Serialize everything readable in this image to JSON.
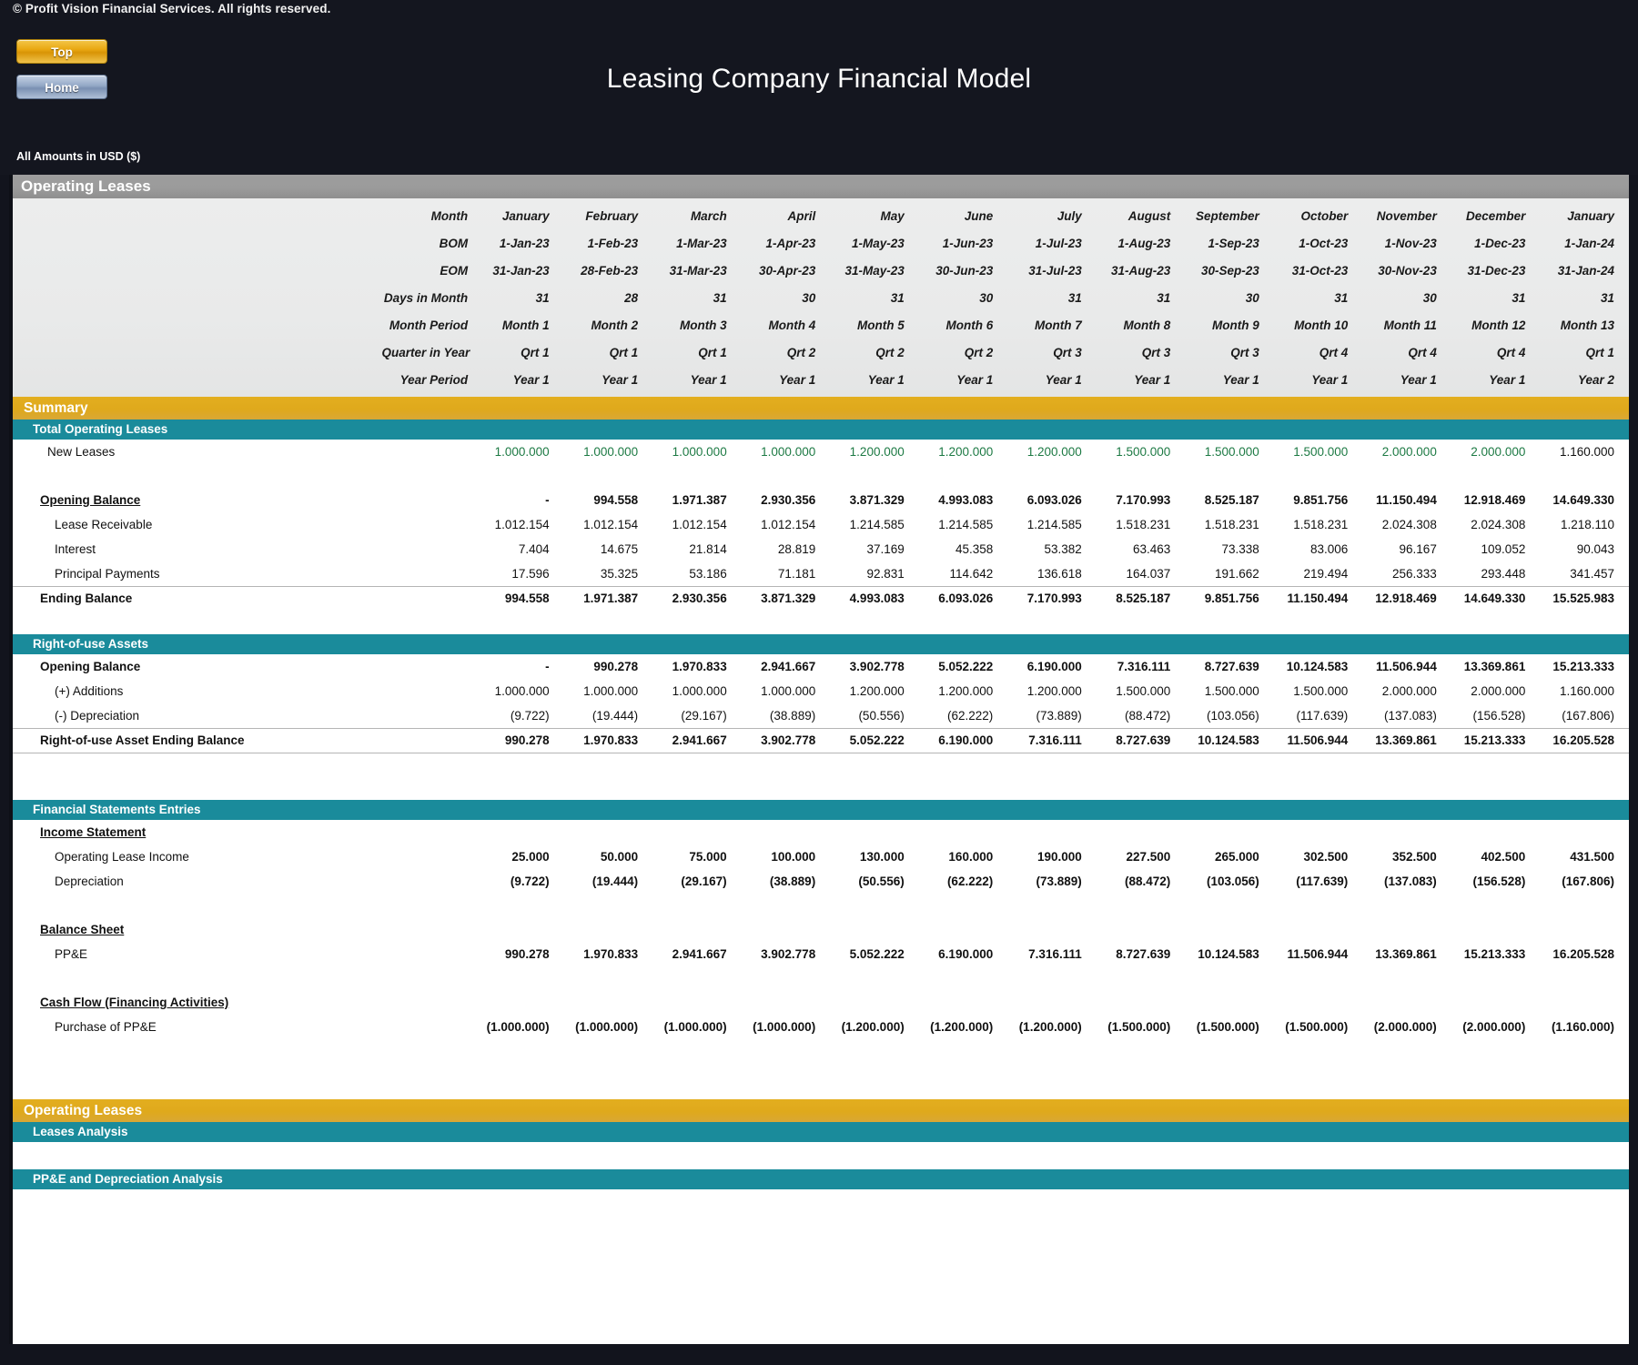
{
  "header": {
    "copyright": "© Profit Vision Financial Services. All rights reserved.",
    "nav_top": "Top",
    "nav_home": "Home",
    "title": "Leasing Company Financial Model",
    "amounts_note": "All Amounts in  USD ($)"
  },
  "sheet": {
    "page_banner": "Operating Leases",
    "summary_banner": "Summary",
    "total_operating_leases_banner": "Total Operating Leases",
    "rou_banner": "Right-of-use Assets",
    "fse_banner": "Financial Statements Entries",
    "bottom_gold_banner": "Operating Leases",
    "leases_analysis_banner": "Leases Analysis",
    "ppe_depreciation_banner": "PP&E and Depreciation Analysis"
  },
  "date_header": {
    "row_labels": [
      "Month",
      "BOM",
      "EOM",
      "Days in Month",
      "Month Period",
      "Quarter in Year",
      "Year Period"
    ],
    "month": [
      "January",
      "February",
      "March",
      "April",
      "May",
      "June",
      "July",
      "August",
      "September",
      "October",
      "November",
      "December",
      "January"
    ],
    "bom": [
      "1-Jan-23",
      "1-Feb-23",
      "1-Mar-23",
      "1-Apr-23",
      "1-May-23",
      "1-Jun-23",
      "1-Jul-23",
      "1-Aug-23",
      "1-Sep-23",
      "1-Oct-23",
      "1-Nov-23",
      "1-Dec-23",
      "1-Jan-24"
    ],
    "eom": [
      "31-Jan-23",
      "28-Feb-23",
      "31-Mar-23",
      "30-Apr-23",
      "31-May-23",
      "30-Jun-23",
      "31-Jul-23",
      "31-Aug-23",
      "30-Sep-23",
      "31-Oct-23",
      "30-Nov-23",
      "31-Dec-23",
      "31-Jan-24"
    ],
    "days_in_month": [
      "31",
      "28",
      "31",
      "30",
      "31",
      "30",
      "31",
      "31",
      "30",
      "31",
      "30",
      "31",
      "31"
    ],
    "month_period": [
      "Month 1",
      "Month 2",
      "Month 3",
      "Month 4",
      "Month 5",
      "Month 6",
      "Month 7",
      "Month 8",
      "Month 9",
      "Month 10",
      "Month 11",
      "Month 12",
      "Month 13"
    ],
    "quarter": [
      "Qrt 1",
      "Qrt 1",
      "Qrt 1",
      "Qrt 2",
      "Qrt 2",
      "Qrt 2",
      "Qrt 3",
      "Qrt 3",
      "Qrt 3",
      "Qrt 4",
      "Qrt 4",
      "Qrt 4",
      "Qrt 1"
    ],
    "year_period": [
      "Year 1",
      "Year 1",
      "Year 1",
      "Year 1",
      "Year 1",
      "Year 1",
      "Year 1",
      "Year 1",
      "Year 1",
      "Year 1",
      "Year 1",
      "Year 1",
      "Year 2"
    ]
  },
  "total_operating_leases": {
    "new_leases": {
      "label": "New Leases",
      "values": [
        "1.000.000",
        "1.000.000",
        "1.000.000",
        "1.000.000",
        "1.200.000",
        "1.200.000",
        "1.200.000",
        "1.500.000",
        "1.500.000",
        "1.500.000",
        "2.000.000",
        "2.000.000",
        "1.160.000"
      ]
    },
    "opening_balance": {
      "label": "Opening Balance",
      "values": [
        "-",
        "994.558",
        "1.971.387",
        "2.930.356",
        "3.871.329",
        "4.993.083",
        "6.093.026",
        "7.170.993",
        "8.525.187",
        "9.851.756",
        "11.150.494",
        "12.918.469",
        "14.649.330"
      ]
    },
    "lease_receivable": {
      "label": "Lease Receivable",
      "values": [
        "1.012.154",
        "1.012.154",
        "1.012.154",
        "1.012.154",
        "1.214.585",
        "1.214.585",
        "1.214.585",
        "1.518.231",
        "1.518.231",
        "1.518.231",
        "2.024.308",
        "2.024.308",
        "1.218.110"
      ]
    },
    "interest": {
      "label": "Interest",
      "values": [
        "7.404",
        "14.675",
        "21.814",
        "28.819",
        "37.169",
        "45.358",
        "53.382",
        "63.463",
        "73.338",
        "83.006",
        "96.167",
        "109.052",
        "90.043"
      ]
    },
    "principal_payments": {
      "label": "Principal Payments",
      "values": [
        "17.596",
        "35.325",
        "53.186",
        "71.181",
        "92.831",
        "114.642",
        "136.618",
        "164.037",
        "191.662",
        "219.494",
        "256.333",
        "293.448",
        "341.457"
      ]
    },
    "ending_balance": {
      "label": "Ending Balance",
      "values": [
        "994.558",
        "1.971.387",
        "2.930.356",
        "3.871.329",
        "4.993.083",
        "6.093.026",
        "7.170.993",
        "8.525.187",
        "9.851.756",
        "11.150.494",
        "12.918.469",
        "14.649.330",
        "15.525.983"
      ]
    }
  },
  "right_of_use_assets": {
    "opening_balance": {
      "label": "Opening Balance",
      "values": [
        "-",
        "990.278",
        "1.970.833",
        "2.941.667",
        "3.902.778",
        "5.052.222",
        "6.190.000",
        "7.316.111",
        "8.727.639",
        "10.124.583",
        "11.506.944",
        "13.369.861",
        "15.213.333"
      ]
    },
    "additions": {
      "label": "(+) Additions",
      "values": [
        "1.000.000",
        "1.000.000",
        "1.000.000",
        "1.000.000",
        "1.200.000",
        "1.200.000",
        "1.200.000",
        "1.500.000",
        "1.500.000",
        "1.500.000",
        "2.000.000",
        "2.000.000",
        "1.160.000"
      ]
    },
    "depreciation": {
      "label": "(-) Depreciation",
      "values": [
        "(9.722)",
        "(19.444)",
        "(29.167)",
        "(38.889)",
        "(50.556)",
        "(62.222)",
        "(73.889)",
        "(88.472)",
        "(103.056)",
        "(117.639)",
        "(137.083)",
        "(156.528)",
        "(167.806)"
      ]
    },
    "ending_balance": {
      "label": "Right-of-use Asset Ending Balance",
      "values": [
        "990.278",
        "1.970.833",
        "2.941.667",
        "3.902.778",
        "5.052.222",
        "6.190.000",
        "7.316.111",
        "8.727.639",
        "10.124.583",
        "11.506.944",
        "13.369.861",
        "15.213.333",
        "16.205.528"
      ]
    }
  },
  "financial_statements": {
    "income_statement_label": "Income Statement",
    "operating_lease_income": {
      "label": "Operating Lease Income",
      "values": [
        "25.000",
        "50.000",
        "75.000",
        "100.000",
        "130.000",
        "160.000",
        "190.000",
        "227.500",
        "265.000",
        "302.500",
        "352.500",
        "402.500",
        "431.500"
      ]
    },
    "depreciation": {
      "label": "Depreciation",
      "values": [
        "(9.722)",
        "(19.444)",
        "(29.167)",
        "(38.889)",
        "(50.556)",
        "(62.222)",
        "(73.889)",
        "(88.472)",
        "(103.056)",
        "(117.639)",
        "(137.083)",
        "(156.528)",
        "(167.806)"
      ]
    },
    "balance_sheet_label": "Balance Sheet",
    "ppe": {
      "label": "PP&E",
      "values": [
        "990.278",
        "1.970.833",
        "2.941.667",
        "3.902.778",
        "5.052.222",
        "6.190.000",
        "7.316.111",
        "8.727.639",
        "10.124.583",
        "11.506.944",
        "13.369.861",
        "15.213.333",
        "16.205.528"
      ]
    },
    "cash_flow_label": "Cash Flow (Financing Activities)",
    "purchase_of_ppe": {
      "label": "Purchase of PP&E",
      "values": [
        "(1.000.000)",
        "(1.000.000)",
        "(1.000.000)",
        "(1.000.000)",
        "(1.200.000)",
        "(1.200.000)",
        "(1.200.000)",
        "(1.500.000)",
        "(1.500.000)",
        "(1.500.000)",
        "(2.000.000)",
        "(2.000.000)",
        "(1.160.000)"
      ]
    }
  },
  "colors": {
    "gold": "#dfa91c",
    "teal": "#1a8b9b",
    "grey_banner": "#9b9b9b",
    "green_input": "#1d7a44",
    "dark_bg": "#14161f"
  }
}
